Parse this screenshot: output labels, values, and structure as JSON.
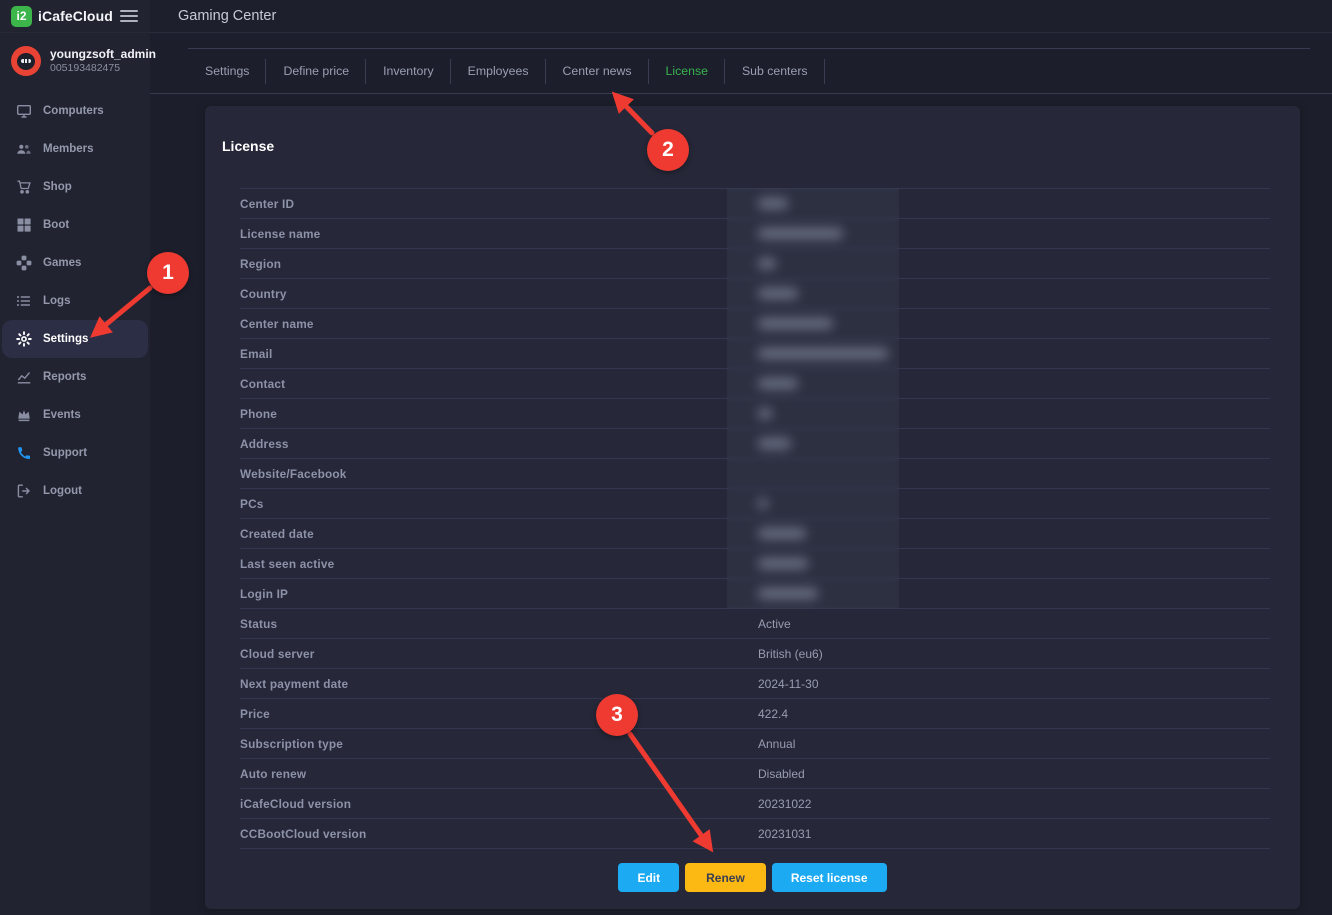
{
  "colors": {
    "accent_green": "#37b44e",
    "logo_green": "#3cb54a",
    "button_blue": "#1caaf2",
    "button_yellow": "#fdb913",
    "annotation_red": "#ee3a31",
    "avatar_red": "#e94335",
    "sidebar_bg": "#212330",
    "main_bg": "#1c1e2b",
    "card_bg": "#262839"
  },
  "brand": {
    "badge": "i2",
    "name": "iCafeCloud"
  },
  "topbar": {
    "title": "Gaming Center"
  },
  "user": {
    "name": "youngzsoft_admin",
    "id": "005193482475"
  },
  "sidebar": {
    "items": [
      {
        "label": "Computers",
        "icon": "computers"
      },
      {
        "label": "Members",
        "icon": "members"
      },
      {
        "label": "Shop",
        "icon": "shop"
      },
      {
        "label": "Boot",
        "icon": "boot"
      },
      {
        "label": "Games",
        "icon": "games"
      },
      {
        "label": "Logs",
        "icon": "logs"
      },
      {
        "label": "Settings",
        "icon": "settings",
        "active": true
      },
      {
        "label": "Reports",
        "icon": "reports"
      },
      {
        "label": "Events",
        "icon": "events"
      },
      {
        "label": "Support",
        "icon": "support"
      },
      {
        "label": "Logout",
        "icon": "logout"
      }
    ]
  },
  "tabs": [
    {
      "label": "Settings"
    },
    {
      "label": "Define price"
    },
    {
      "label": "Inventory"
    },
    {
      "label": "Employees"
    },
    {
      "label": "Center news"
    },
    {
      "label": "License",
      "active": true
    },
    {
      "label": "Sub centers"
    }
  ],
  "license": {
    "title": "License",
    "rows": [
      {
        "label": "Center ID",
        "value": "",
        "redacted": true,
        "blob_width": 30
      },
      {
        "label": "License name",
        "value": "",
        "redacted": true,
        "blob_width": 85
      },
      {
        "label": "Region",
        "value": "",
        "redacted": true,
        "blob_width": 18
      },
      {
        "label": "Country",
        "value": "",
        "redacted": true,
        "blob_width": 40
      },
      {
        "label": "Center name",
        "value": "",
        "redacted": true,
        "blob_width": 75
      },
      {
        "label": "Email",
        "value": "",
        "redacted": true,
        "blob_width": 130
      },
      {
        "label": "Contact",
        "value": "",
        "redacted": true,
        "blob_width": 40
      },
      {
        "label": "Phone",
        "value": "",
        "redacted": true,
        "blob_width": 14
      },
      {
        "label": "Address",
        "value": "",
        "redacted": true,
        "blob_width": 33
      },
      {
        "label": "Website/Facebook",
        "value": "",
        "redacted": false
      },
      {
        "label": "PCs",
        "value": "",
        "redacted": true,
        "blob_width": 10
      },
      {
        "label": "Created date",
        "value": "",
        "redacted": true,
        "blob_width": 48
      },
      {
        "label": "Last seen active",
        "value": "",
        "redacted": true,
        "blob_width": 50
      },
      {
        "label": "Login IP",
        "value": "",
        "redacted": true,
        "blob_width": 60
      },
      {
        "label": "Status",
        "value": "Active"
      },
      {
        "label": "Cloud server",
        "value": "British (eu6)"
      },
      {
        "label": "Next payment date",
        "value": "2024-11-30"
      },
      {
        "label": "Price",
        "value": "422.4"
      },
      {
        "label": "Subscription type",
        "value": "Annual"
      },
      {
        "label": "Auto renew",
        "value": "Disabled"
      },
      {
        "label": "iCafeCloud version",
        "value": "20231022"
      },
      {
        "label": "CCBootCloud version",
        "value": "20231031"
      }
    ]
  },
  "actions": {
    "buttons": [
      {
        "label": "Edit",
        "color": "blue"
      },
      {
        "label": "Renew",
        "color": "yellow"
      },
      {
        "label": "Reset license",
        "color": "blue"
      }
    ]
  },
  "annotations": {
    "steps": [
      "1",
      "2",
      "3"
    ]
  }
}
